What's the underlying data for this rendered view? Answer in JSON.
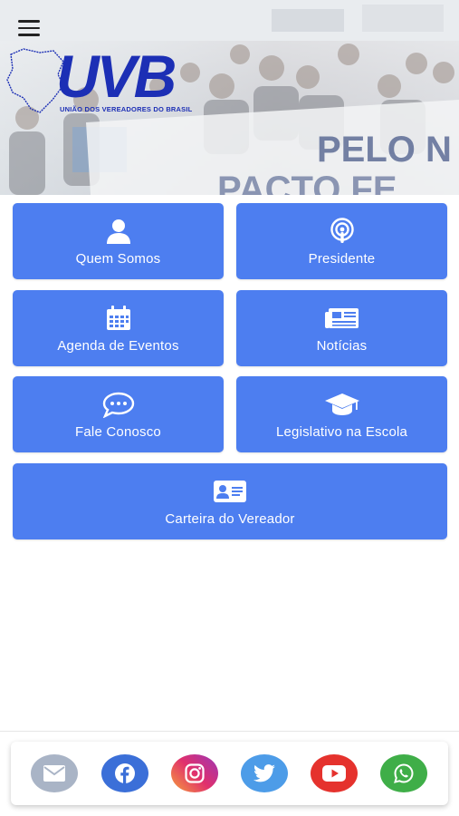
{
  "header": {
    "logo_text": "UVB",
    "logo_subtitle": "UNIÃO DOS VEREADORES DO BRASIL",
    "banner_text_line1": "PELO N",
    "banner_text_line2": "PACTO FE"
  },
  "tiles": [
    {
      "label": "Quem Somos",
      "icon": "user-icon"
    },
    {
      "label": "Presidente",
      "icon": "podcast-icon"
    },
    {
      "label": "Agenda de Eventos",
      "icon": "calendar-icon"
    },
    {
      "label": "Notícias",
      "icon": "newspaper-icon"
    },
    {
      "label": "Fale Conosco",
      "icon": "chat-bubble-icon"
    },
    {
      "label": "Legislativo na Escola",
      "icon": "graduation-cap-icon"
    },
    {
      "label": "Carteira do Vereador",
      "icon": "id-card-icon"
    }
  ],
  "social": [
    {
      "name": "email",
      "color": "#a9b4c6"
    },
    {
      "name": "facebook",
      "color": "#3b6fd8"
    },
    {
      "name": "instagram",
      "color": "#d6336c"
    },
    {
      "name": "twitter",
      "color": "#4d9ce8"
    },
    {
      "name": "youtube",
      "color": "#e5322d"
    },
    {
      "name": "whatsapp",
      "color": "#3fae48"
    }
  ],
  "colors": {
    "tile": "#4d7ef0",
    "brand": "#1c2fb5"
  }
}
